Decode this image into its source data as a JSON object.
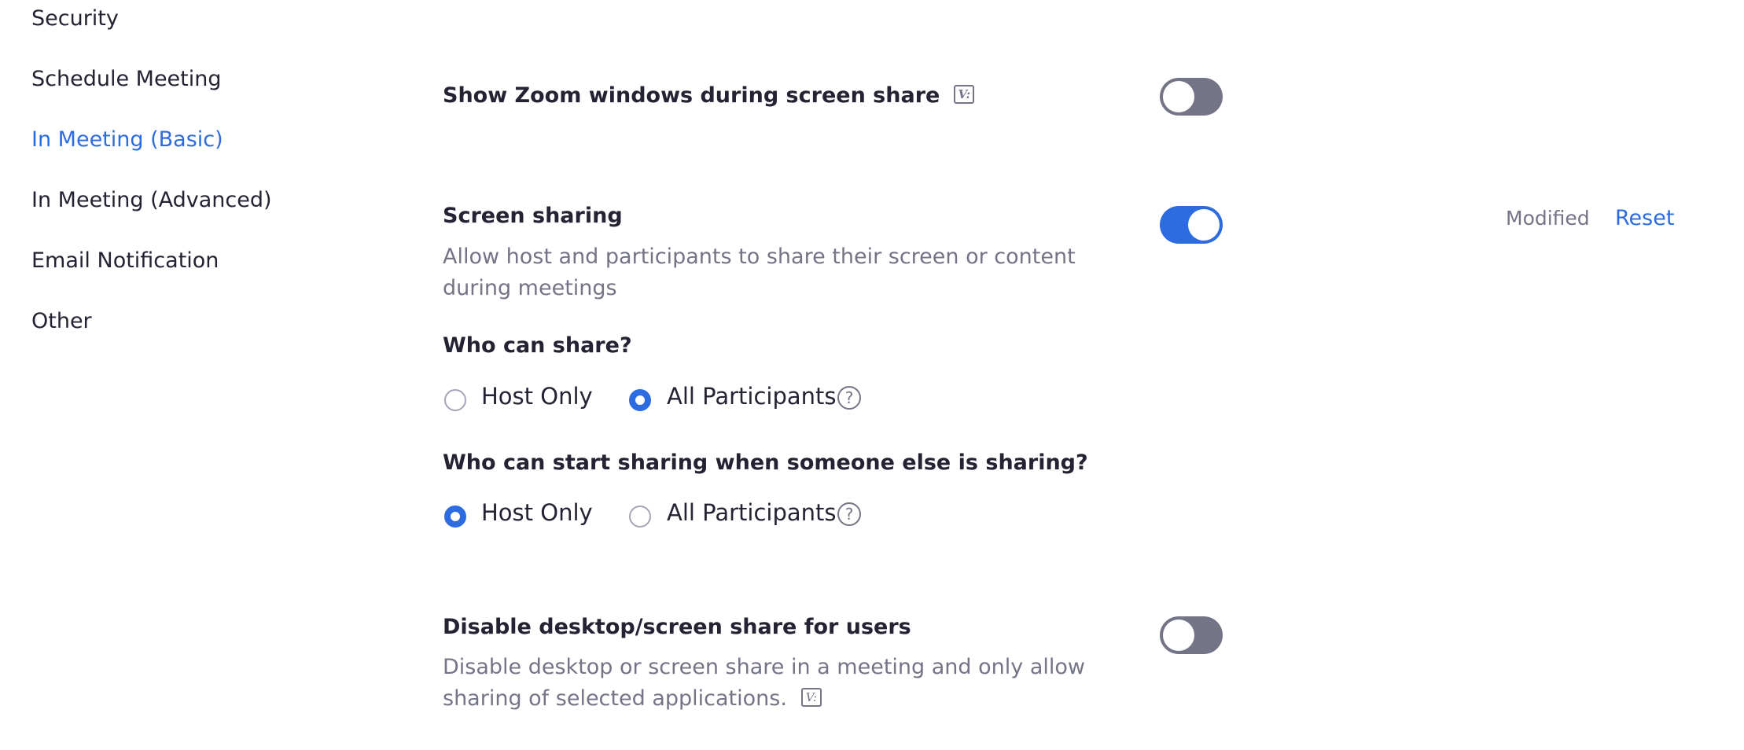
{
  "sidebar": {
    "items": [
      {
        "label": "Security"
      },
      {
        "label": "Schedule Meeting"
      },
      {
        "label": "In Meeting (Basic)",
        "active": true
      },
      {
        "label": "In Meeting (Advanced)"
      },
      {
        "label": "Email Notification"
      },
      {
        "label": "Other"
      }
    ]
  },
  "settings": {
    "show_zoom_windows": {
      "title": "Show Zoom windows during screen share",
      "icon": "version-icon",
      "icon_glyph": "V:",
      "enabled": false
    },
    "screen_sharing": {
      "title": "Screen sharing",
      "description": "Allow host and participants to share their screen or content during meetings",
      "enabled": true,
      "modified_label": "Modified",
      "reset_label": "Reset",
      "who_can_share": {
        "question": "Who can share?",
        "options": [
          "Host Only",
          "All Participants"
        ],
        "selected": "All Participants"
      },
      "who_can_start": {
        "question": "Who can start sharing when someone else is sharing?",
        "options": [
          "Host Only",
          "All Participants"
        ],
        "selected": "Host Only"
      },
      "help_glyph": "?"
    },
    "disable_desktop_share": {
      "title": "Disable desktop/screen share for users",
      "description": "Disable desktop or screen share in a meeting and only allow sharing of selected applications.",
      "icon_glyph": "V:",
      "enabled": false
    }
  },
  "colors": {
    "accent": "#2D6BE0",
    "text": "#232333",
    "muted": "#747487",
    "toggle_off": "#747487"
  }
}
